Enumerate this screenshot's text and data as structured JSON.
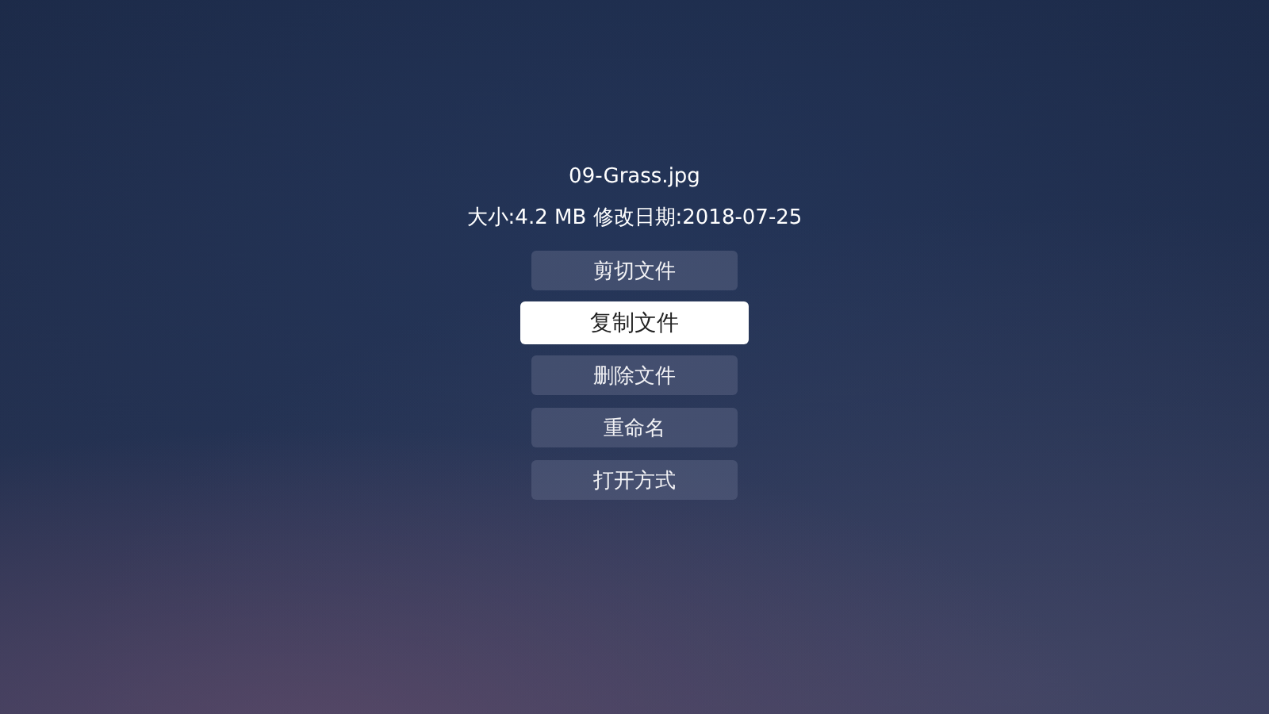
{
  "file": {
    "name": "09-Grass.jpg",
    "info": "大小:4.2 MB 修改日期:2018-07-25"
  },
  "actions": [
    {
      "label": "剪切文件",
      "selected": false
    },
    {
      "label": "复制文件",
      "selected": true
    },
    {
      "label": "删除文件",
      "selected": false
    },
    {
      "label": "重命名",
      "selected": false
    },
    {
      "label": "打开方式",
      "selected": false
    }
  ]
}
